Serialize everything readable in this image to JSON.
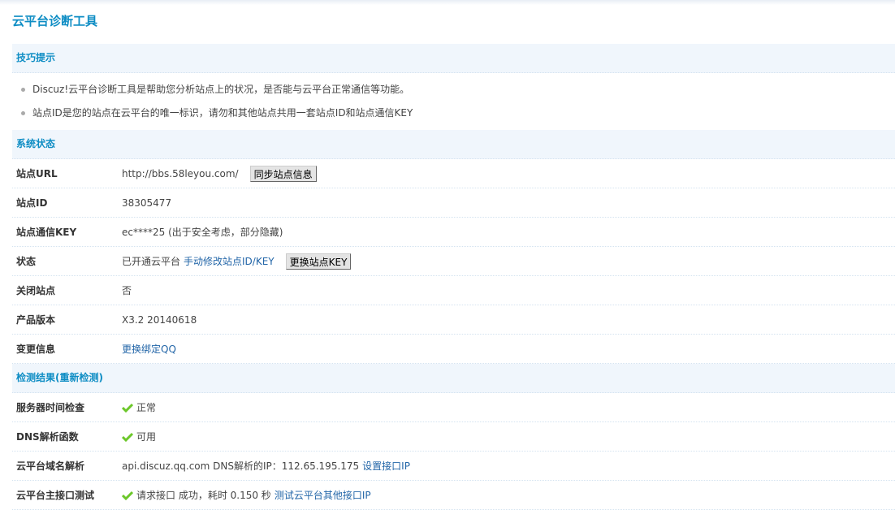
{
  "title": "云平台诊断工具",
  "tips": {
    "header": "技巧提示",
    "items": [
      "Discuz!云平台诊断工具是帮助您分析站点上的状况，是否能与云平台正常通信等功能。",
      "站点ID是您的站点在云平台的唯一标识，请勿和其他站点共用一套站点ID和站点通信KEY"
    ]
  },
  "status": {
    "header": "系统状态",
    "url_label": "站点URL",
    "url": "http://bbs.58leyou.com/",
    "sync_button": "同步站点信息",
    "id_label": "站点ID",
    "id": "38305477",
    "key_label": "站点通信KEY",
    "key": "ec****25 (出于安全考虑，部分隐藏)",
    "state_label": "状态",
    "state": "已开通云平台",
    "edit_link": "手动修改站点ID/KEY",
    "change_key_button": "更换站点KEY",
    "closed_label": "关闭站点",
    "closed": "否",
    "version_label": "产品版本",
    "version": "X3.2 20140618",
    "change_label": "变更信息",
    "change_link": "更换绑定QQ"
  },
  "results": {
    "header": "检测结果",
    "recheck": "(重新检测)",
    "time_label": "服务器时间检查",
    "time": "正常",
    "dns_label": "DNS解析函数",
    "dns": "可用",
    "domain_label": "云平台域名解析",
    "domain": "api.discuz.qq.com DNS解析的IP：112.65.195.175",
    "domain_link": "设置接口IP",
    "api_label": "云平台主接口测试",
    "api": "请求接口 成功，耗时 0.150 秒",
    "api_link": "测试云平台其他接口IP"
  },
  "colors": {
    "accent": "#0e8dc4",
    "link": "#2366a8",
    "check": "#6cc72a"
  }
}
